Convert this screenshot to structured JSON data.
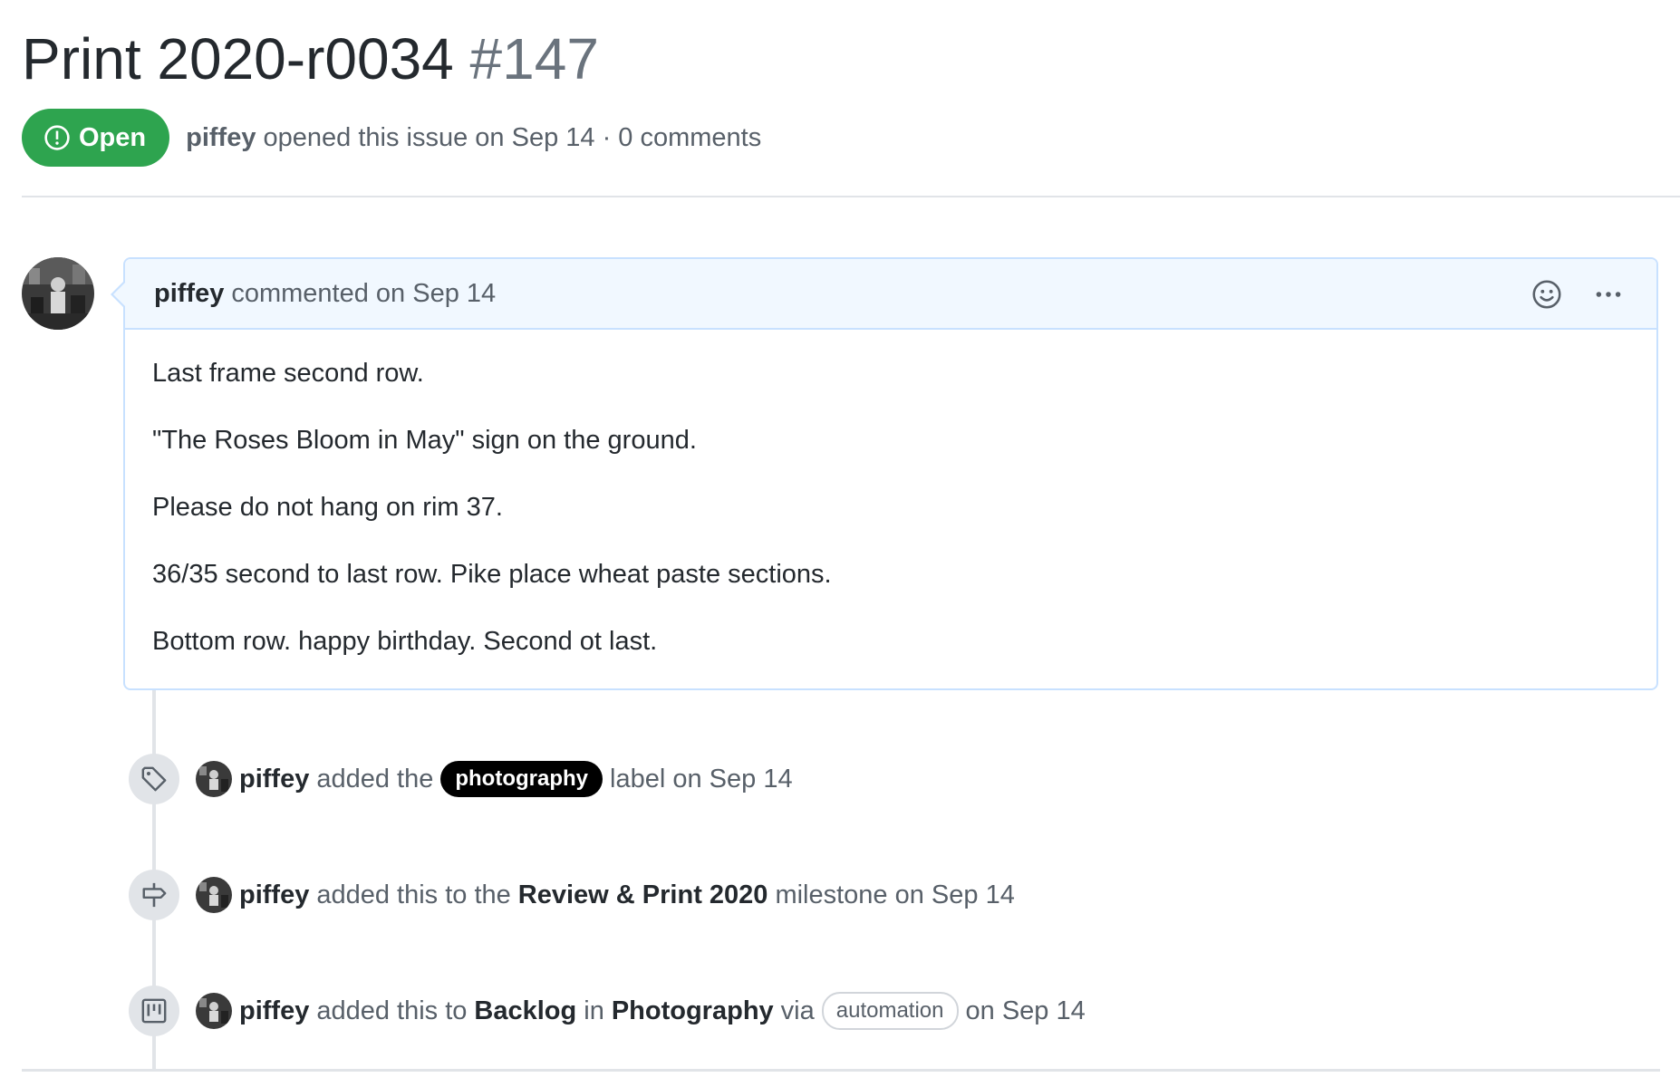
{
  "issue": {
    "title": "Print 2020-r0034",
    "number": "#147",
    "state_label": "Open",
    "author": "piffey",
    "opened_text": "opened this issue on Sep 14 · 0 comments"
  },
  "comment": {
    "author": "piffey",
    "header_text": "commented on Sep 14",
    "body": [
      "Last frame second row.",
      "\"The Roses Bloom in May\" sign on the ground.",
      "Please do not hang on rim 37.",
      "36/35 second to last row. Pike place wheat paste sections.",
      "Bottom row. happy birthday. Second ot last."
    ]
  },
  "timeline": {
    "label_event": {
      "author": "piffey",
      "text_before": "added the",
      "label": "photography",
      "text_after": "label on Sep 14"
    },
    "milestone_event": {
      "author": "piffey",
      "text_before": "added this to the",
      "milestone": "Review & Print 2020",
      "text_after": "milestone on Sep 14"
    },
    "project_event": {
      "author": "piffey",
      "text_before": "added this to",
      "column": "Backlog",
      "text_in": "in",
      "project": "Photography",
      "text_via": "via",
      "via_badge": "automation",
      "text_after": "on Sep 14"
    }
  },
  "icons": {
    "state": "issue-opened-icon",
    "reaction": "smiley-icon",
    "more": "kebab-horizontal-icon",
    "label": "tag-icon",
    "milestone": "milestone-icon",
    "project": "project-icon"
  },
  "colors": {
    "open_green": "#2ea44f",
    "comment_header_bg": "#f1f8ff",
    "comment_border": "#c8e1ff",
    "label_bg": "#000000"
  }
}
